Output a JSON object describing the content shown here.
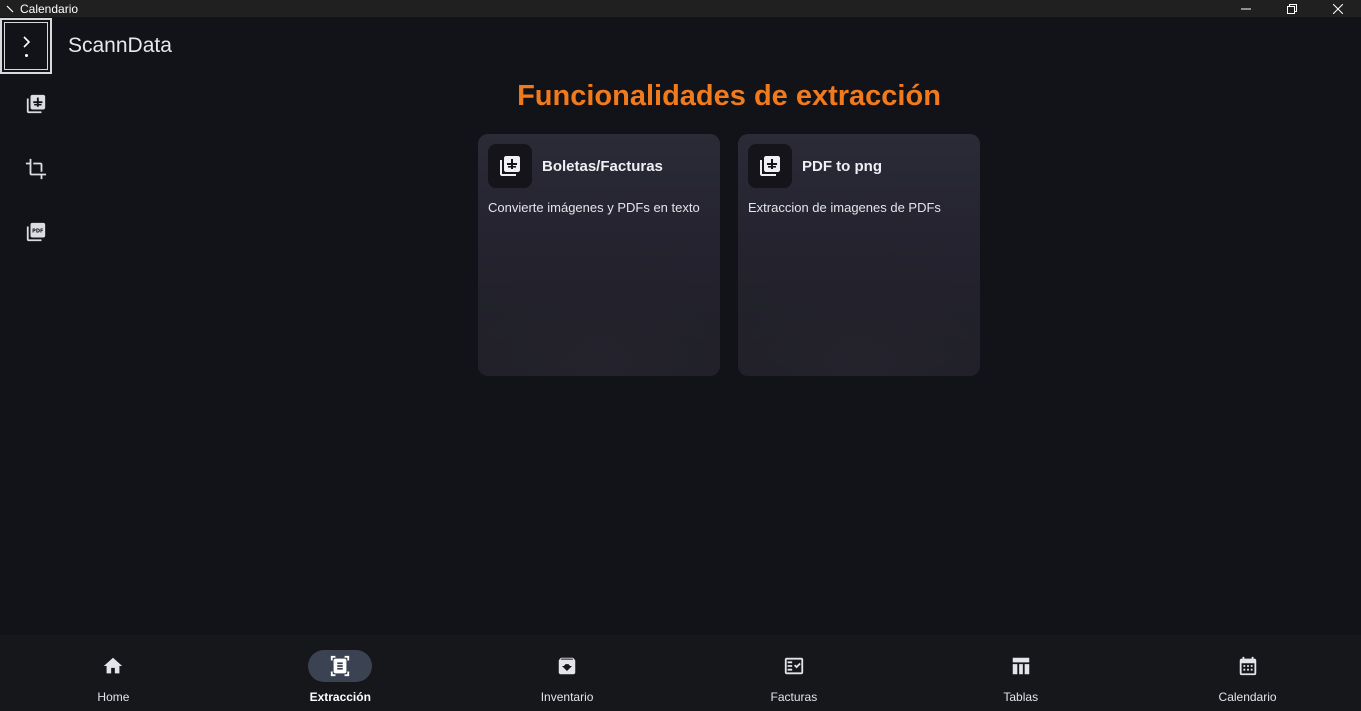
{
  "window": {
    "title": "Calendario",
    "icons": {
      "app": "app-icon",
      "minimize": "minimize-icon",
      "restore": "restore-icon",
      "close": "close-icon"
    }
  },
  "header": {
    "app_name": "ScannData",
    "menu_icon": "chevron-right-icon"
  },
  "rail": {
    "items": [
      {
        "icon": "file-add-icon"
      },
      {
        "icon": "crop-icon"
      },
      {
        "icon": "pdf-icon"
      }
    ]
  },
  "main": {
    "heading": "Funcionalidades de extracción",
    "cards": [
      {
        "title": "Boletas/Facturas",
        "description": "Convierte imágenes y PDFs en texto",
        "icon": "file-add-icon"
      },
      {
        "title": "PDF to png",
        "description": "Extraccion de imagenes de PDFs",
        "icon": "file-add-icon"
      }
    ]
  },
  "bottom_nav": {
    "items": [
      {
        "label": "Home",
        "icon": "home-icon"
      },
      {
        "label": "Extracción",
        "icon": "document-scanner-icon",
        "active": true
      },
      {
        "label": "Inventario",
        "icon": "archive-icon"
      },
      {
        "label": "Facturas",
        "icon": "fact-check-icon"
      },
      {
        "label": "Tablas",
        "icon": "table-icon"
      },
      {
        "label": "Calendario",
        "icon": "calendar-icon"
      }
    ]
  },
  "colors": {
    "background": "#111318",
    "accent": "#f07a1c",
    "card": "#2b2a37",
    "active_pill": "#3b4352"
  }
}
